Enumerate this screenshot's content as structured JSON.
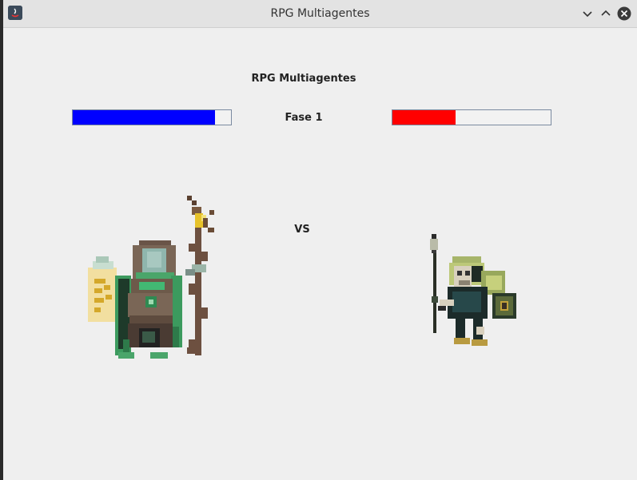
{
  "window": {
    "title": "RPG Multiagentes",
    "icons": {
      "app": "java-app-icon",
      "minimize": "chevron-down-icon",
      "maximize": "chevron-up-icon",
      "close": "close-icon"
    }
  },
  "game": {
    "title": "RPG Multiagentes",
    "phase_label": "Fase 1",
    "vs_label": "VS",
    "player": {
      "sprite": "hooded-druid-with-staff-and-scroll",
      "health_fraction": 0.9,
      "bar_color": "#0000ff"
    },
    "enemy": {
      "sprite": "goblin-spearman-with-shield",
      "health_fraction": 0.4,
      "bar_color": "#ff0000"
    }
  }
}
